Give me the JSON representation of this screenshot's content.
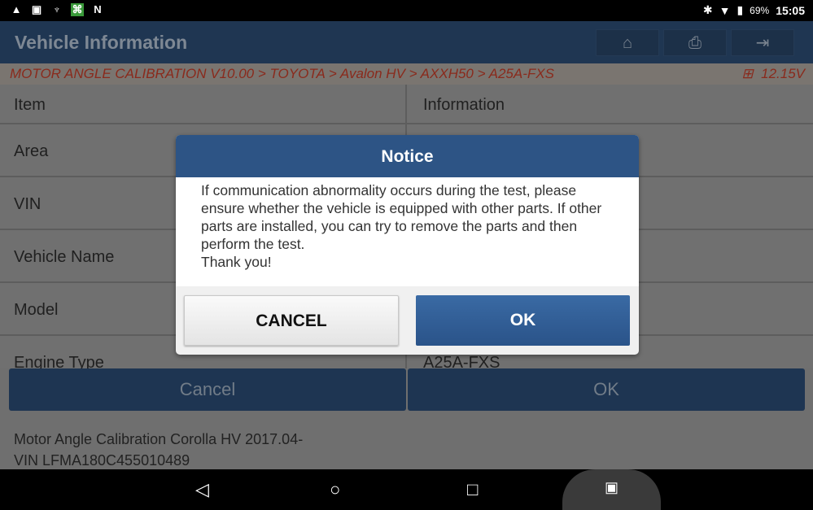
{
  "status_bar": {
    "icons_left": [
      "warning-icon",
      "image-icon",
      "stethoscope-icon",
      "app-icon",
      "n-icon"
    ],
    "icons_right": [
      "bluetooth-icon",
      "wifi-icon",
      "battery-icon"
    ],
    "battery": "69%",
    "time": "15:05"
  },
  "header": {
    "title": "Vehicle Information",
    "buttons": [
      "home-icon",
      "print-icon",
      "exit-icon"
    ]
  },
  "breadcrumb": {
    "path": "MOTOR ANGLE CALIBRATION V10.00 > TOYOTA > Avalon HV > AXXH50 > A25A-FXS",
    "voltage": "12.15V"
  },
  "table": {
    "headers": [
      "Item",
      "Information"
    ],
    "rows": [
      {
        "item": "Area",
        "info": ""
      },
      {
        "item": "VIN",
        "info": ""
      },
      {
        "item": "Vehicle Name",
        "info": ""
      },
      {
        "item": "Model",
        "info": ""
      },
      {
        "item": "Engine Type",
        "info": "A25A-FXS"
      }
    ]
  },
  "bottom_buttons": {
    "cancel": "Cancel",
    "ok": "OK"
  },
  "footer": {
    "line1": "Motor Angle Calibration Corolla HV 2017.04-",
    "line2": "VIN LFMA180C455010489"
  },
  "dialog": {
    "title": "Notice",
    "message": "If communication abnormality occurs during the test, please ensure whether the vehicle is equipped with other parts. If other parts are installed, you can try to remove the parts and then perform the test.",
    "thanks": "Thank you!",
    "cancel": "CANCEL",
    "ok": "OK"
  },
  "colors": {
    "header": "#1f3652",
    "dialog_header": "#2d5485",
    "ok_button": "#2d5a92",
    "breadcrumb_text": "#8a2a1c"
  }
}
